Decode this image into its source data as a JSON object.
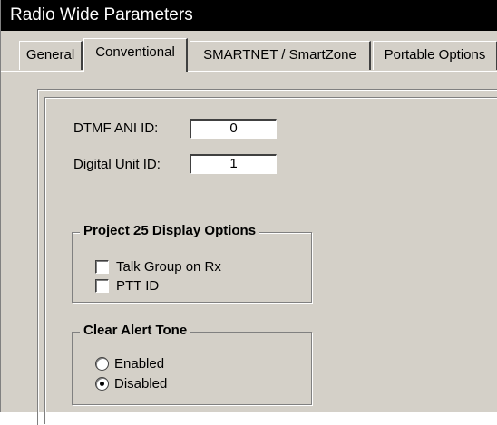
{
  "window": {
    "title": "Radio Wide Parameters"
  },
  "tabs": [
    {
      "label": "General"
    },
    {
      "label": "Conventional",
      "active": true
    },
    {
      "label": "SMARTNET / SmartZone"
    },
    {
      "label": "Portable Options"
    }
  ],
  "fields": {
    "dtmf_ani_id": {
      "label": "DTMF ANI ID:",
      "value": "0"
    },
    "digital_unit_id": {
      "label": "Digital Unit ID:",
      "value": "1"
    }
  },
  "p25_display": {
    "title": "Project 25 Display Options",
    "options": [
      {
        "label": "Talk Group on Rx",
        "checked": false
      },
      {
        "label": "PTT ID",
        "checked": false
      }
    ]
  },
  "clear_alert_tone": {
    "title": "Clear Alert Tone",
    "options": [
      {
        "label": "Enabled",
        "selected": false
      },
      {
        "label": "Disabled",
        "selected": true
      }
    ]
  }
}
